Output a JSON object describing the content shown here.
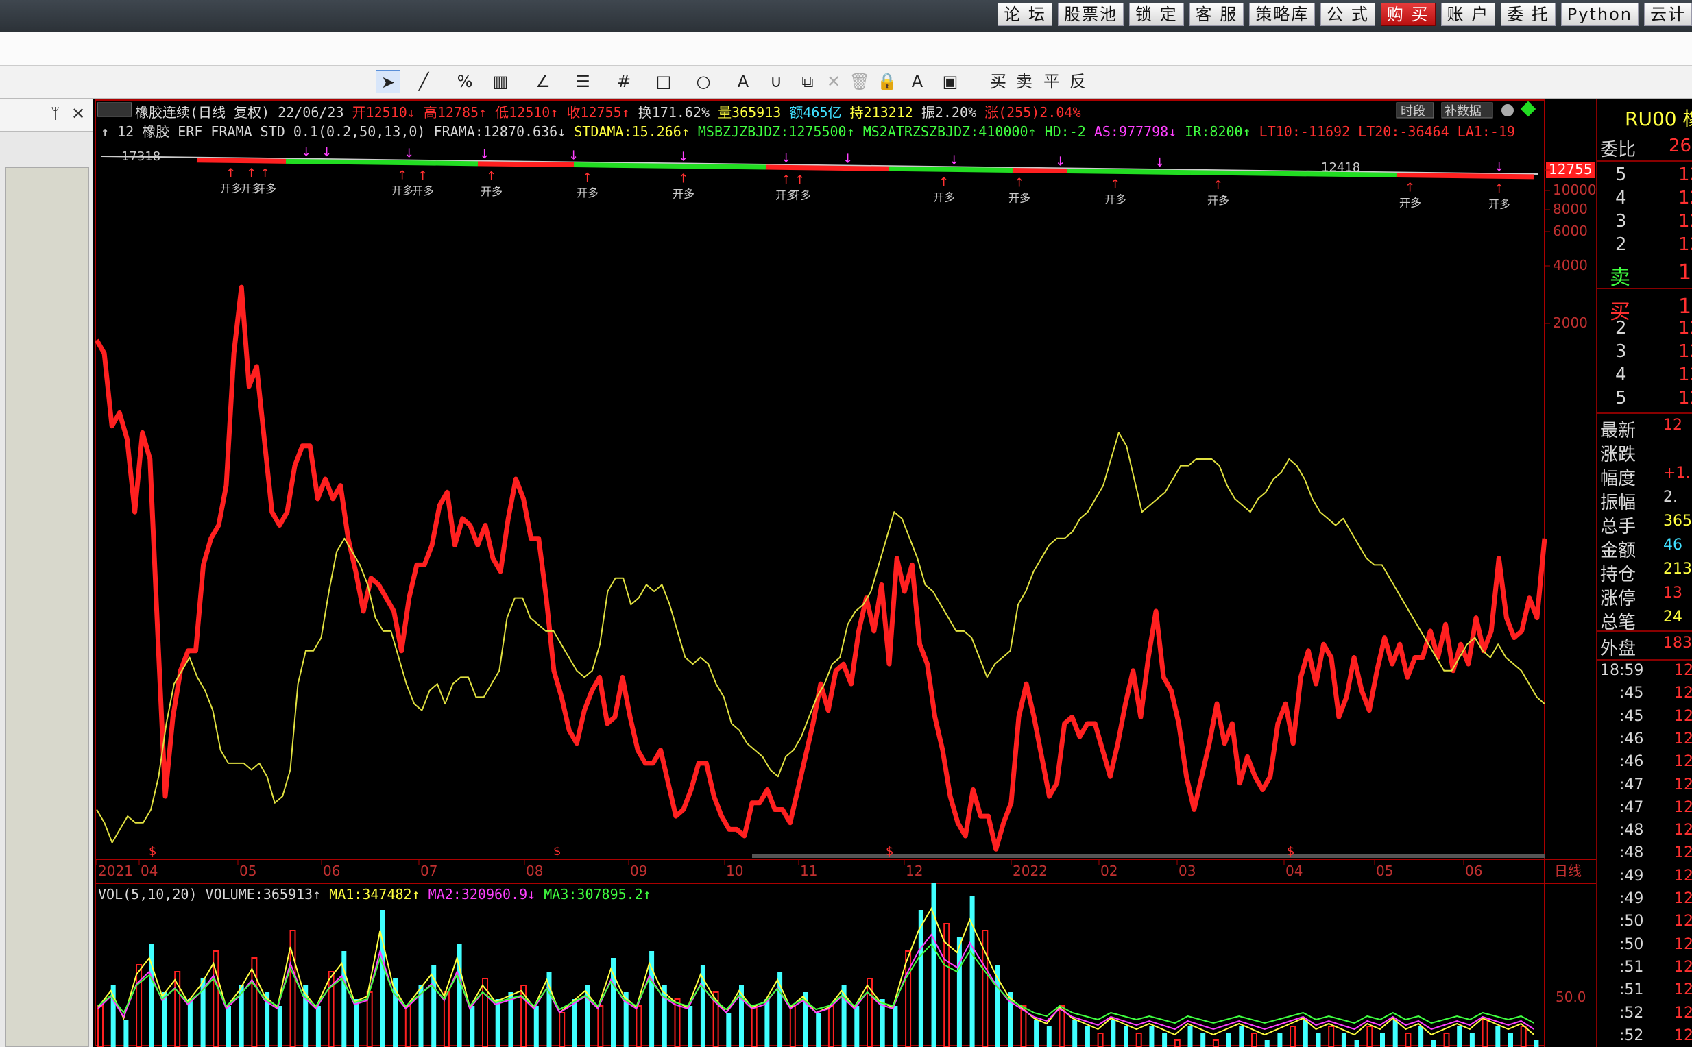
{
  "topbar": {
    "buttons": [
      {
        "label": "论 坛",
        "name": "forum-button"
      },
      {
        "label": "股票池",
        "name": "stock-pool-button"
      },
      {
        "label": "锁 定",
        "name": "lock-button"
      },
      {
        "label": "客 服",
        "name": "service-button"
      },
      {
        "label": "策略库",
        "name": "strategy-button"
      },
      {
        "label": "公 式",
        "name": "formula-button"
      },
      {
        "label": "购 买",
        "name": "buy-button",
        "red": true
      },
      {
        "label": "账 户",
        "name": "account-button"
      },
      {
        "label": "委 托",
        "name": "order-button"
      },
      {
        "label": "Python",
        "name": "python-button"
      },
      {
        "label": "云计",
        "name": "cloud-button"
      }
    ]
  },
  "toolbar": {
    "tools": [
      {
        "glyph": "➤",
        "name": "cursor-tool-icon",
        "selected": true
      },
      {
        "glyph": "╱",
        "name": "line-tool-icon"
      },
      {
        "glyph": "%",
        "name": "percent-tool-icon"
      },
      {
        "glyph": "▥",
        "name": "fib-tool-icon"
      },
      {
        "glyph": "∠",
        "name": "angle-tool-icon"
      },
      {
        "glyph": "☰",
        "name": "channel-tool-icon"
      },
      {
        "glyph": "#",
        "name": "grid-tool-icon"
      },
      {
        "glyph": "□",
        "name": "rect-tool-icon"
      },
      {
        "glyph": "○",
        "name": "circle-tool-icon"
      },
      {
        "glyph": "A",
        "name": "text-tool-icon"
      },
      {
        "glyph": "∪",
        "name": "magnet-tool-icon"
      },
      {
        "glyph": "⧉",
        "name": "copy-tool-icon"
      },
      {
        "glyph": "✕",
        "name": "delete-tool-icon"
      },
      {
        "glyph": "🗑",
        "name": "trash-tool-icon"
      },
      {
        "glyph": "🔒",
        "name": "lock-tool-icon"
      },
      {
        "glyph": "A",
        "name": "color-tool-icon"
      },
      {
        "glyph": "▣",
        "name": "save-tool-icon"
      },
      {
        "glyph": "买",
        "name": "buy-mark-tool"
      },
      {
        "glyph": "卖",
        "name": "sell-mark-tool"
      },
      {
        "glyph": "平",
        "name": "close-mark-tool"
      },
      {
        "glyph": "反",
        "name": "reverse-mark-tool"
      }
    ]
  },
  "panel": {
    "pin": "ᛘ",
    "close": "✕"
  },
  "info": {
    "row1": [
      {
        "t": "橡胶连续(日线 复权) 22/06/23",
        "c": "#d8d8d8"
      },
      {
        "t": "开12510↓",
        "c": "#ff3030"
      },
      {
        "t": "高12785↑",
        "c": "#ff3030"
      },
      {
        "t": "低12510↑",
        "c": "#ff3030"
      },
      {
        "t": "收12755↑",
        "c": "#ff3030"
      },
      {
        "t": "换171.62%",
        "c": "#d8d8d8"
      },
      {
        "t": "量365913",
        "c": "#ffff40"
      },
      {
        "t": "额465亿",
        "c": "#40e0ff"
      },
      {
        "t": "持213212",
        "c": "#ffff40"
      },
      {
        "t": "振2.20%",
        "c": "#d8d8d8"
      },
      {
        "t": "涨(255)2.04%",
        "c": "#ff3030"
      }
    ],
    "row2": [
      {
        "t": "↑ 12 橡胶 ERF FRAMA STD 0.1(0.2,50,13,0)",
        "c": "#d8d8d8"
      },
      {
        "t": "FRAMA:12870.636↓",
        "c": "#d8d8d8"
      },
      {
        "t": "STDAMA:15.266↑",
        "c": "#ffff40"
      },
      {
        "t": "MSBZJZBJDZ:1275500↑",
        "c": "#40ff40"
      },
      {
        "t": "MS2ATRZSZBJDZ:410000↑",
        "c": "#40ff40"
      },
      {
        "t": "HD:-2",
        "c": "#40ff40"
      },
      {
        "t": "AS:977798↓",
        "c": "#ff40ff"
      },
      {
        "t": "IR:8200↑",
        "c": "#40ff40"
      },
      {
        "t": "LT10:-11692",
        "c": "#ff3030"
      },
      {
        "t": "LT20:-36464",
        "c": "#ff3030"
      },
      {
        "t": "LA1:-19",
        "c": "#ff3030"
      }
    ],
    "buttons": {
      "time": "时段",
      "fill": "补数据"
    }
  },
  "price_axis": {
    "labels": [
      "12755",
      "10000",
      "8000",
      "6000",
      "4000",
      "2000"
    ]
  },
  "markers": {
    "near_high": "17318",
    "near_right": "12418"
  },
  "x_axis": {
    "labels": [
      "2021",
      "04",
      "05",
      "06",
      "07",
      "08",
      "09",
      "10",
      "11",
      "12",
      "2022",
      "02",
      "03",
      "04",
      "05",
      "06"
    ],
    "period": "日线"
  },
  "volume": {
    "title": "VOL(5,10,20)",
    "volume": "VOLUME:365913↑",
    "ma1": "MA1:347482↑",
    "ma2": "MA2:320960.9↓",
    "ma3": "MA3:307895.2↑",
    "axis": "50.0"
  },
  "right": {
    "symbol": "RU00 橡",
    "weibi_label": "委比",
    "weibi_value": "26.",
    "sell_levels": [
      "5",
      "4",
      "3",
      "2"
    ],
    "sell_label": "卖",
    "buy_label": "买",
    "buy_levels": [
      "2",
      "3",
      "4",
      "5"
    ],
    "level_value": "12",
    "stats": [
      {
        "label": "最新",
        "value": "12",
        "c": "#ff3030"
      },
      {
        "label": "涨跌",
        "value": "",
        "c": "#ff3030"
      },
      {
        "label": "幅度",
        "value": "+1.",
        "c": "#ff3030"
      },
      {
        "label": "振幅",
        "value": "2.",
        "c": "#d8d8d8"
      },
      {
        "label": "总手",
        "value": "365",
        "c": "#ffff40"
      },
      {
        "label": "金额",
        "value": "46",
        "c": "#40e0ff"
      },
      {
        "label": "持仓",
        "value": "213",
        "c": "#ffff40"
      },
      {
        "label": "涨停",
        "value": "13",
        "c": "#ff3030"
      },
      {
        "label": "总笔",
        "value": "24",
        "c": "#ffff40"
      }
    ],
    "outer_label": "外盘",
    "outer_value": "183",
    "ticks": [
      "18:59",
      ":45",
      ":45",
      ":46",
      ":46",
      ":47",
      ":47",
      ":48",
      ":48",
      ":49",
      ":49",
      ":50",
      ":50",
      ":51",
      ":51",
      ":52",
      ":52"
    ],
    "tick_value": "12"
  },
  "chart_data": {
    "type": "line",
    "title": "橡胶连续(日线 复权)",
    "y_axis_labels": [
      12755,
      10000,
      8000,
      6000,
      4000,
      2000
    ],
    "x_axis_labels": [
      "2021",
      "04",
      "05",
      "06",
      "07",
      "08",
      "09",
      "10",
      "11",
      "12",
      "2022",
      "02",
      "03",
      "04",
      "05",
      "06"
    ],
    "series": [
      {
        "name": "",
        "color": "#ff2020",
        "values": [
          0.22,
          0.24,
          0.35,
          0.33,
          0.37,
          0.48,
          0.36,
          0.4,
          0.66,
          0.91,
          0.79,
          0.72,
          0.69,
          0.69,
          0.56,
          0.52,
          0.5,
          0.44,
          0.24,
          0.14,
          0.29,
          0.26,
          0.37,
          0.48,
          0.5,
          0.48,
          0.41,
          0.38,
          0.38,
          0.46,
          0.43,
          0.46,
          0.44,
          0.52,
          0.57,
          0.63,
          0.58,
          0.59,
          0.61,
          0.63,
          0.69,
          0.61,
          0.56,
          0.56,
          0.53,
          0.47,
          0.45,
          0.53,
          0.49,
          0.5,
          0.53,
          0.5,
          0.55,
          0.57,
          0.49,
          0.43,
          0.46,
          0.52,
          0.52,
          0.61,
          0.72,
          0.76,
          0.81,
          0.83,
          0.78,
          0.75,
          0.73,
          0.8,
          0.79,
          0.73,
          0.79,
          0.84,
          0.86,
          0.86,
          0.84,
          0.89,
          0.94,
          0.93,
          0.9,
          0.86,
          0.86,
          0.91,
          0.94,
          0.96,
          0.96,
          0.97,
          0.92,
          0.92,
          0.9,
          0.93,
          0.93,
          0.95,
          0.9,
          0.85,
          0.8,
          0.74,
          0.78,
          0.72,
          0.71,
          0.74,
          0.66,
          0.61,
          0.66,
          0.59,
          0.71,
          0.55,
          0.6,
          0.56,
          0.68,
          0.71,
          0.79,
          0.84,
          0.91,
          0.95,
          0.97,
          0.9,
          0.94,
          0.94,
          0.99,
          0.95,
          0.92,
          0.79,
          0.74,
          0.79,
          0.85,
          0.91,
          0.89,
          0.8,
          0.79,
          0.82,
          0.8,
          0.8,
          0.84,
          0.88,
          0.83,
          0.77,
          0.72,
          0.79,
          0.7,
          0.63,
          0.73,
          0.75,
          0.8,
          0.88,
          0.93,
          0.88,
          0.83,
          0.77,
          0.83,
          0.8,
          0.89,
          0.85,
          0.88,
          0.9,
          0.88,
          0.8,
          0.77,
          0.83,
          0.73,
          0.69,
          0.74,
          0.68,
          0.7,
          0.79,
          0.76,
          0.7,
          0.75,
          0.78,
          0.72,
          0.67,
          0.71,
          0.68,
          0.73,
          0.7,
          0.7,
          0.66,
          0.7,
          0.65,
          0.72,
          0.68,
          0.71,
          0.64,
          0.69,
          0.66,
          0.55,
          0.64,
          0.67,
          0.66,
          0.61,
          0.64,
          0.52
        ]
      },
      {
        "name": "",
        "color": "#e0e040",
        "values": [
          0.93,
          0.95,
          0.98,
          0.96,
          0.94,
          0.95,
          0.95,
          0.93,
          0.88,
          0.8,
          0.74,
          0.72,
          0.7,
          0.73,
          0.75,
          0.78,
          0.84,
          0.86,
          0.86,
          0.86,
          0.87,
          0.86,
          0.88,
          0.92,
          0.91,
          0.87,
          0.74,
          0.69,
          0.69,
          0.67,
          0.6,
          0.54,
          0.52,
          0.54,
          0.56,
          0.59,
          0.64,
          0.66,
          0.66,
          0.7,
          0.74,
          0.77,
          0.78,
          0.75,
          0.74,
          0.77,
          0.74,
          0.73,
          0.73,
          0.76,
          0.76,
          0.74,
          0.72,
          0.64,
          0.61,
          0.61,
          0.64,
          0.65,
          0.66,
          0.66,
          0.68,
          0.7,
          0.72,
          0.73,
          0.72,
          0.68,
          0.6,
          0.58,
          0.58,
          0.62,
          0.61,
          0.59,
          0.6,
          0.59,
          0.62,
          0.66,
          0.7,
          0.71,
          0.7,
          0.71,
          0.74,
          0.76,
          0.8,
          0.81,
          0.83,
          0.84,
          0.85,
          0.87,
          0.88,
          0.85,
          0.84,
          0.82,
          0.79,
          0.76,
          0.74,
          0.71,
          0.7,
          0.65,
          0.63,
          0.62,
          0.6,
          0.56,
          0.52,
          0.48,
          0.49,
          0.52,
          0.55,
          0.59,
          0.6,
          0.62,
          0.64,
          0.66,
          0.66,
          0.67,
          0.7,
          0.73,
          0.71,
          0.7,
          0.69,
          0.62,
          0.6,
          0.57,
          0.55,
          0.53,
          0.52,
          0.52,
          0.51,
          0.49,
          0.48,
          0.46,
          0.44,
          0.4,
          0.36,
          0.38,
          0.43,
          0.48,
          0.47,
          0.46,
          0.45,
          0.43,
          0.41,
          0.41,
          0.4,
          0.4,
          0.4,
          0.41,
          0.44,
          0.46,
          0.47,
          0.48,
          0.46,
          0.45,
          0.43,
          0.42,
          0.4,
          0.41,
          0.43,
          0.46,
          0.48,
          0.49,
          0.5,
          0.49,
          0.51,
          0.53,
          0.55,
          0.56,
          0.56,
          0.58,
          0.6,
          0.62,
          0.64,
          0.66,
          0.68,
          0.7,
          0.72,
          0.72,
          0.7,
          0.68,
          0.67,
          0.69,
          0.7,
          0.68,
          0.7,
          0.71,
          0.72,
          0.74,
          0.76,
          0.77
        ]
      }
    ]
  }
}
